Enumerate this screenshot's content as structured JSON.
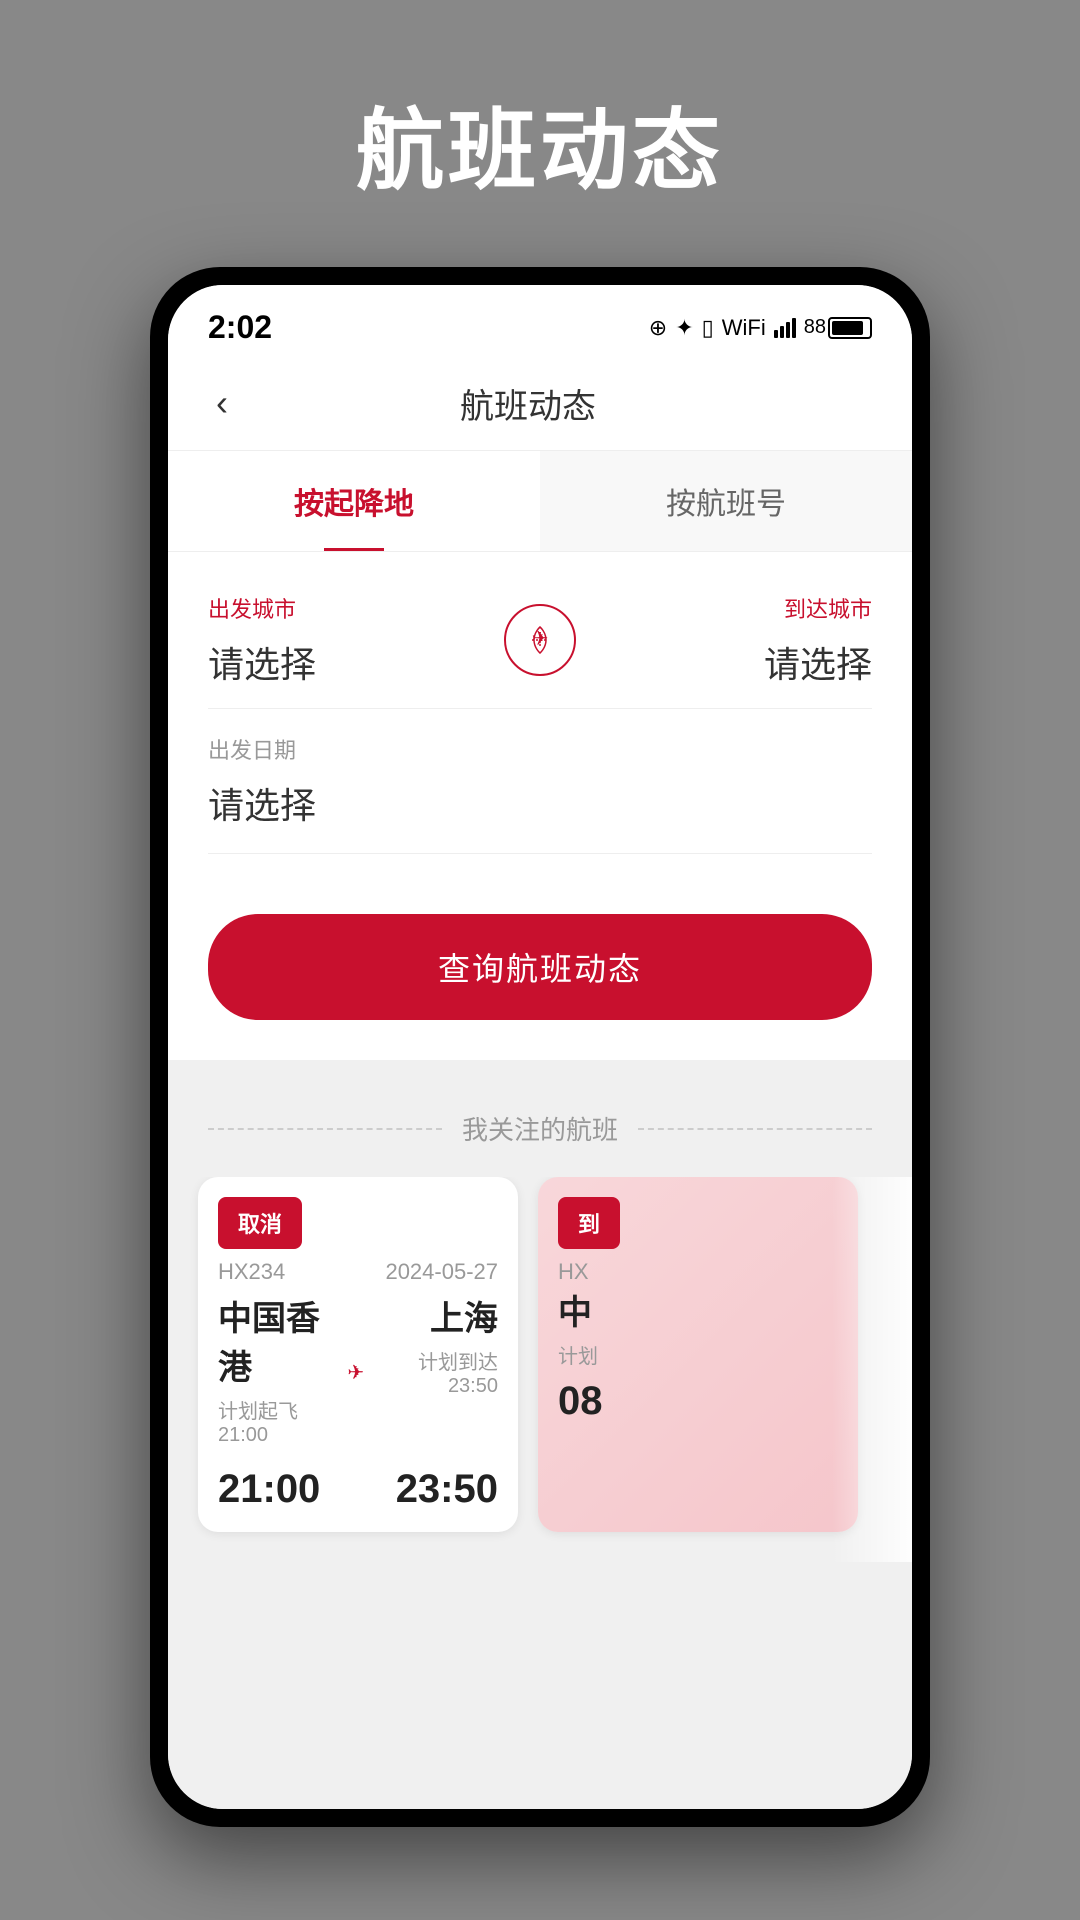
{
  "page": {
    "background_title": "航班动态",
    "title": "航班动态"
  },
  "status_bar": {
    "time": "2:02",
    "battery": "88"
  },
  "nav": {
    "back_label": "‹",
    "title": "航班动态"
  },
  "tabs": [
    {
      "id": "by-route",
      "label": "按起降地",
      "active": true
    },
    {
      "id": "by-number",
      "label": "按航班号",
      "active": false
    }
  ],
  "form": {
    "departure_label": "出发城市",
    "arrival_label": "到达城市",
    "departure_placeholder": "请选择",
    "arrival_placeholder": "请选择",
    "date_label": "出发日期",
    "date_placeholder": "请选择",
    "search_button": "查询航班动态"
  },
  "followed_section": {
    "title": "我关注的航班"
  },
  "flight_cards": [
    {
      "status": "取消",
      "status_type": "cancel",
      "flight_number": "HX234",
      "date": "2024-05-27",
      "departure_city": "中国香港",
      "arrival_city": "上海",
      "planned_depart_label": "计划起飞 21:00",
      "planned_arrive_label": "计划到达 23:50",
      "actual_depart_time": "21:00",
      "actual_arrive_time": "23:50"
    },
    {
      "status": "到",
      "status_type": "arrive",
      "flight_number": "HX",
      "date": "",
      "departure_city": "中",
      "arrival_city": "",
      "planned_depart_label": "计划",
      "planned_arrive_label": "",
      "actual_depart_time": "08",
      "actual_arrive_time": ""
    }
  ]
}
